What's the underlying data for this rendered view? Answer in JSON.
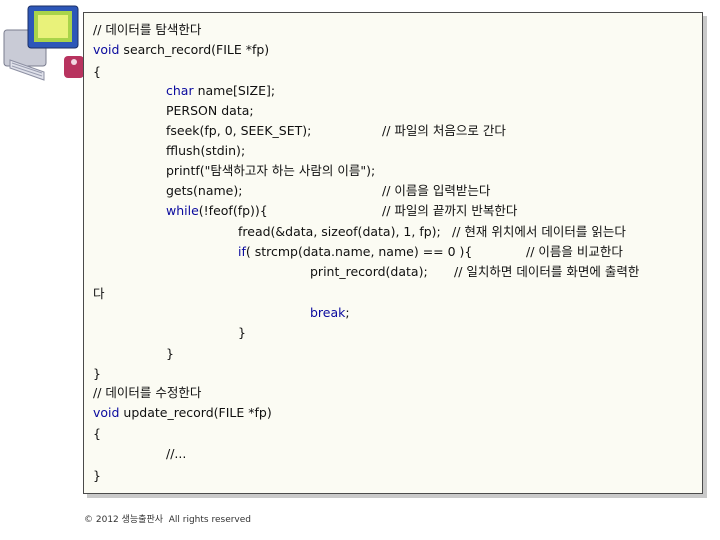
{
  "code": {
    "lines": [
      {
        "text": "// 데이터를 탐색한다"
      },
      {
        "kw": "void",
        "text": " search_record(FILE *fp)"
      },
      {
        "text": "{"
      },
      {
        "kw": "char",
        "text": " name[SIZE];"
      },
      {
        "text": "PERSON data;"
      },
      {
        "text": "fseek(fp, 0, SEEK_SET);",
        "comment": "// 파일의 처음으로 간다"
      },
      {
        "text": "fflush(stdin);"
      },
      {
        "text": "printf(\"탐색하고자 하는 사람의 이름\");"
      },
      {
        "text": "gets(name);",
        "comment": "// 이름을 입력받는다"
      },
      {
        "kw": "while",
        "text": "(!feof(fp)){",
        "comment": "// 파일의 끝까지 반복한다"
      },
      {
        "text": "fread(&data, sizeof(data), 1, fp);",
        "comment": "// 현재 위치에서 데이터를 읽는다"
      },
      {
        "kw": "if",
        "text": "( strcmp(data.name, name) == 0 ){",
        "comment": "// 이름을 비교한다"
      },
      {
        "text": "print_record(data);",
        "comment": "// 일치하면 데이터를 화면에 출력한"
      },
      {
        "text": "다"
      },
      {
        "kw": "break",
        "text": ";"
      },
      {
        "text": "}"
      },
      {
        "text": "}"
      },
      {
        "text": "}"
      },
      {
        "text": "// 데이터를 수정한다"
      },
      {
        "kw": "void",
        "text": " update_record(FILE *fp)"
      },
      {
        "text": "{"
      },
      {
        "text": "//..."
      },
      {
        "text": "}"
      }
    ]
  },
  "footer": {
    "text": "© 2012 생능출판사  All rights reserved"
  }
}
